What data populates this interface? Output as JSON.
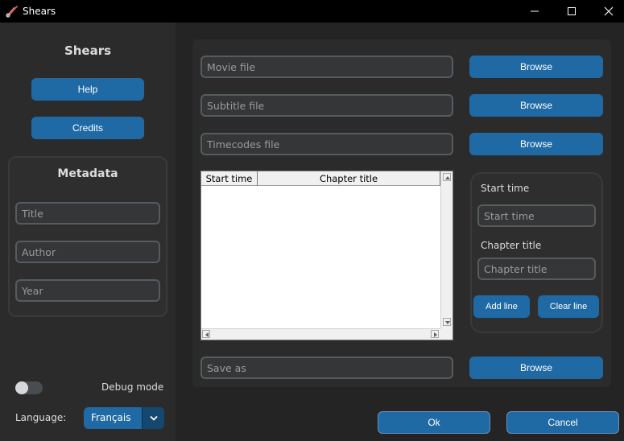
{
  "window": {
    "title": "Shears",
    "minimize_icon": "minimize-icon",
    "maximize_icon": "maximize-icon",
    "close_icon": "close-icon"
  },
  "sidebar": {
    "title": "Shears",
    "help_label": "Help",
    "credits_label": "Credits",
    "metadata": {
      "title": "Metadata",
      "title_placeholder": "Title",
      "author_placeholder": "Author",
      "year_placeholder": "Year"
    },
    "debug_label": "Debug mode",
    "debug_enabled": false,
    "language_label": "Language:",
    "language_value": "Français"
  },
  "files": {
    "movie_placeholder": "Movie file",
    "subtitle_placeholder": "Subtitle file",
    "timecodes_placeholder": "Timecodes file",
    "save_placeholder": "Save as",
    "browse_label": "Browse"
  },
  "chapters": {
    "columns": [
      "Start time",
      "Chapter title"
    ],
    "rows": [],
    "start_time_label": "Start time",
    "start_time_placeholder": "Start time",
    "chapter_title_label": "Chapter title",
    "chapter_title_placeholder": "Chapter title",
    "add_label": "Add line",
    "clear_label": "Clear line"
  },
  "dialog": {
    "ok_label": "Ok",
    "cancel_label": "Cancel"
  },
  "colors": {
    "accent": "#1f6aa5",
    "background": "#242424",
    "panel": "#2b2b2b"
  }
}
